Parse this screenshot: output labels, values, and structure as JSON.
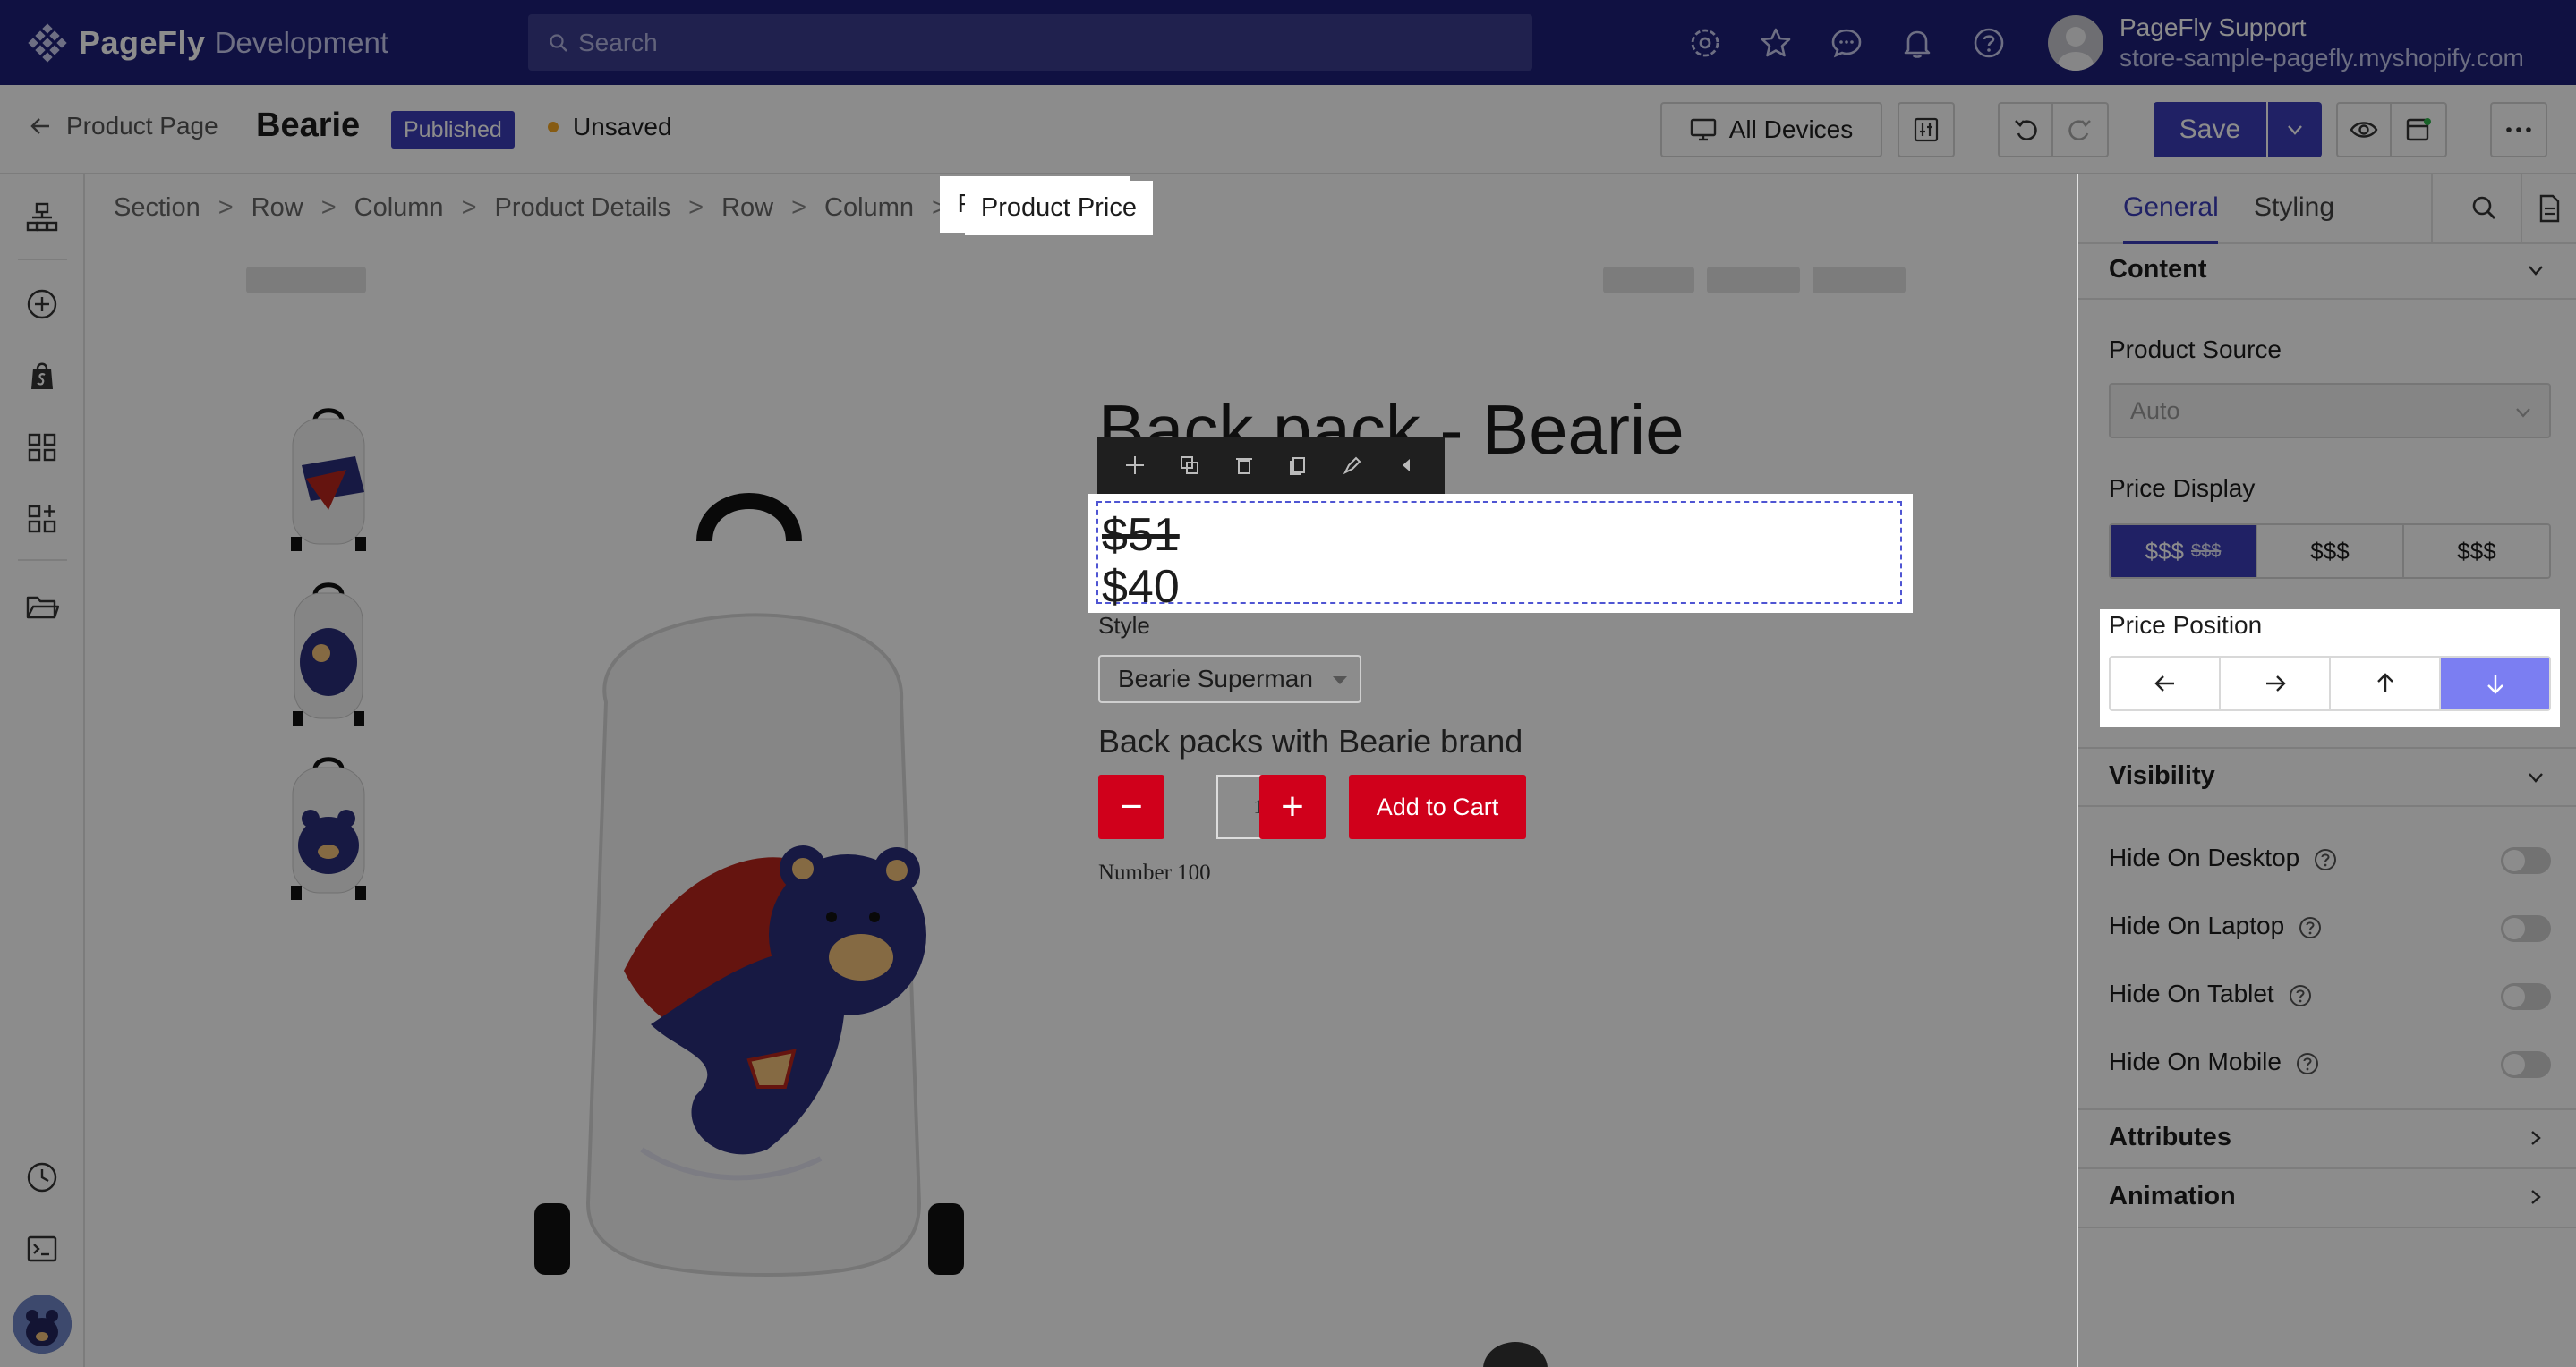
{
  "topbar": {
    "brand": "PageFly",
    "brand_suffix": "Development",
    "search_placeholder": "Search",
    "user_name": "PageFly Support",
    "user_store": "store-sample-pagefly.myshopify.com"
  },
  "subheader": {
    "back_label": "Product Page",
    "page_name": "Bearie",
    "status_badge": "Published",
    "unsaved_label": "Unsaved",
    "devices_label": "All Devices",
    "save_label": "Save"
  },
  "breadcrumb": {
    "items": [
      "Section",
      "Row",
      "Column",
      "Product Details",
      "Row",
      "Column"
    ],
    "separator": ">",
    "active": "Product Price"
  },
  "product": {
    "title": "Back pack - Bearie",
    "compare_price": "$51",
    "price": "$40",
    "style_label": "Style",
    "style_value": "Bearie Superman",
    "description": "Back packs with Bearie brand",
    "quantity": "1",
    "minus": "−",
    "plus": "+",
    "add_to_cart": "Add to Cart",
    "number_label": "Number",
    "number_value": "100"
  },
  "panel": {
    "tabs": [
      "General",
      "Styling"
    ],
    "active_tab": "General",
    "content_header": "Content",
    "product_source_label": "Product Source",
    "product_source_value": "Auto",
    "price_display_label": "Price Display",
    "price_display_options": [
      "$$$",
      "$$$",
      "$$$"
    ],
    "price_display_strike": "$$$",
    "price_position_label": "Price Position",
    "price_position_active": "down",
    "visibility_header": "Visibility",
    "hide_desktop": "Hide On Desktop",
    "hide_laptop": "Hide On Laptop",
    "hide_tablet": "Hide On Tablet",
    "hide_mobile": "Hide On Mobile",
    "attributes_header": "Attributes",
    "animation_header": "Animation"
  },
  "colors": {
    "brand": "#1e2079",
    "primary": "#3b3db8",
    "accent_light": "#7b7ef2",
    "danger": "#d0001b"
  }
}
